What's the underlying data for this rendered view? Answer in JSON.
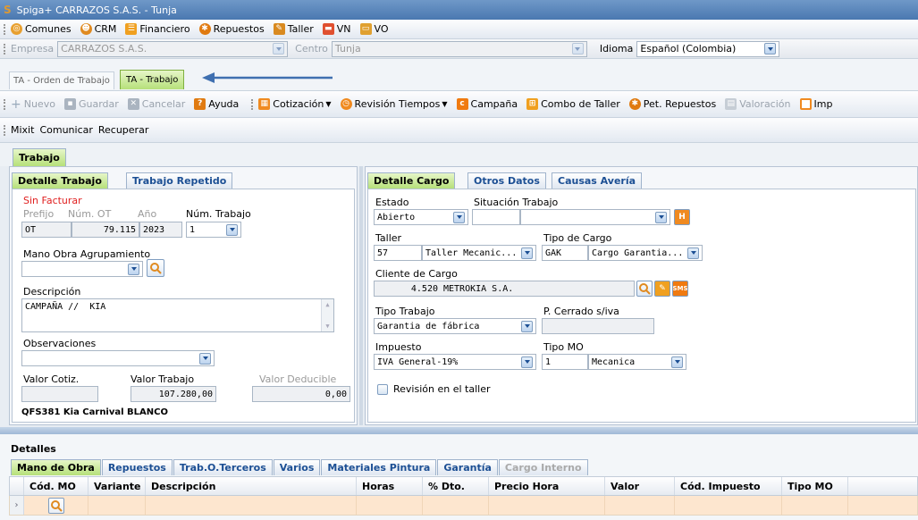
{
  "window": {
    "title": "Spiga+ CARRAZOS S.A.S. - Tunja"
  },
  "menu": [
    "Comunes",
    "CRM",
    "Financiero",
    "Repuestos",
    "Taller",
    "VN",
    "VO"
  ],
  "context": {
    "empresa_label": "Empresa",
    "empresa_value": "CARRAZOS S.A.S.",
    "centro_label": "Centro",
    "centro_value": "Tunja",
    "idioma_label": "Idioma",
    "idioma_value": "Español (Colombia)"
  },
  "doc_tabs": [
    "TA - Orden de Trabajo",
    "TA - Trabajo"
  ],
  "toolbar": {
    "nuevo": "Nuevo",
    "guardar": "Guardar",
    "cancelar": "Cancelar",
    "ayuda": "Ayuda",
    "cotizacion": "Cotización",
    "revision": "Revisión Tiempos",
    "campana": "Campaña",
    "combo": "Combo de Taller",
    "pet": "Pet. Repuestos",
    "valoracion": "Valoración",
    "imp": "Imp"
  },
  "toolbar2": [
    "Mixit",
    "Comunicar",
    "Recuperar"
  ],
  "main_tab": "Trabajo",
  "left": {
    "tabs": [
      "Detalle Trabajo",
      "Trabajo Repetido"
    ],
    "status": "Sin Facturar",
    "prefijo_label": "Prefijo",
    "num_ot_label": "Núm. OT",
    "ano_label": "Año",
    "num_trabajo_label": "Núm. Trabajo",
    "prefijo": "OT",
    "num_ot": "79.115",
    "ano": "2023",
    "num_trabajo": "1",
    "mano_obra_label": "Mano Obra Agrupamiento",
    "descripcion_label": "Descripción",
    "descripcion": "CAMPAÑA //  KIA",
    "observaciones_label": "Observaciones",
    "valor_cotiz_label": "Valor Cotiz.",
    "valor_trabajo_label": "Valor Trabajo",
    "valor_deducible_label": "Valor Deducible",
    "valor_trabajo": "107.280,00",
    "valor_deducible": "0,00",
    "vehicle": "QFS381 Kia Carnival BLANCO"
  },
  "right": {
    "tabs": [
      "Detalle Cargo",
      "Otros Datos",
      "Causas Avería"
    ],
    "estado_label": "Estado",
    "estado": "Abierto",
    "situacion_label": "Situación Trabajo",
    "h_btn": "H",
    "taller_label": "Taller",
    "taller_code": "57",
    "taller": "Taller Mecanic...",
    "tipo_cargo_label": "Tipo de Cargo",
    "tipo_cargo_code": "GAK",
    "tipo_cargo": "Cargo Garantia...",
    "cliente_label": "Cliente de Cargo",
    "cliente_code": "4.520",
    "cliente": "METROKIA S.A.",
    "sms": "SMS",
    "tipo_trabajo_label": "Tipo Trabajo",
    "tipo_trabajo": "Garantia de fábrica",
    "p_cerrado_label": "P. Cerrado s/iva",
    "impuesto_label": "Impuesto",
    "impuesto": "IVA General-19%",
    "tipo_mo_label": "Tipo MO",
    "tipo_mo_code": "1",
    "tipo_mo": "Mecanica",
    "revision_label": "Revisión en el taller"
  },
  "detalles": {
    "title": "Detalles",
    "tabs": [
      "Mano de Obra",
      "Repuestos",
      "Trab.O.Terceros",
      "Varios",
      "Materiales Pintura",
      "Garantía",
      "Cargo Interno"
    ],
    "columns": [
      "Cód. MO",
      "Variante",
      "Descripción",
      "Horas",
      "% Dto.",
      "Precio Hora",
      "Valor",
      "Cód. Impuesto",
      "Tipo MO"
    ]
  },
  "colors": {
    "title": "#4a78b0",
    "tab_active": "#b6e07a",
    "link": "#1c4f94",
    "alert": "#e02020"
  }
}
